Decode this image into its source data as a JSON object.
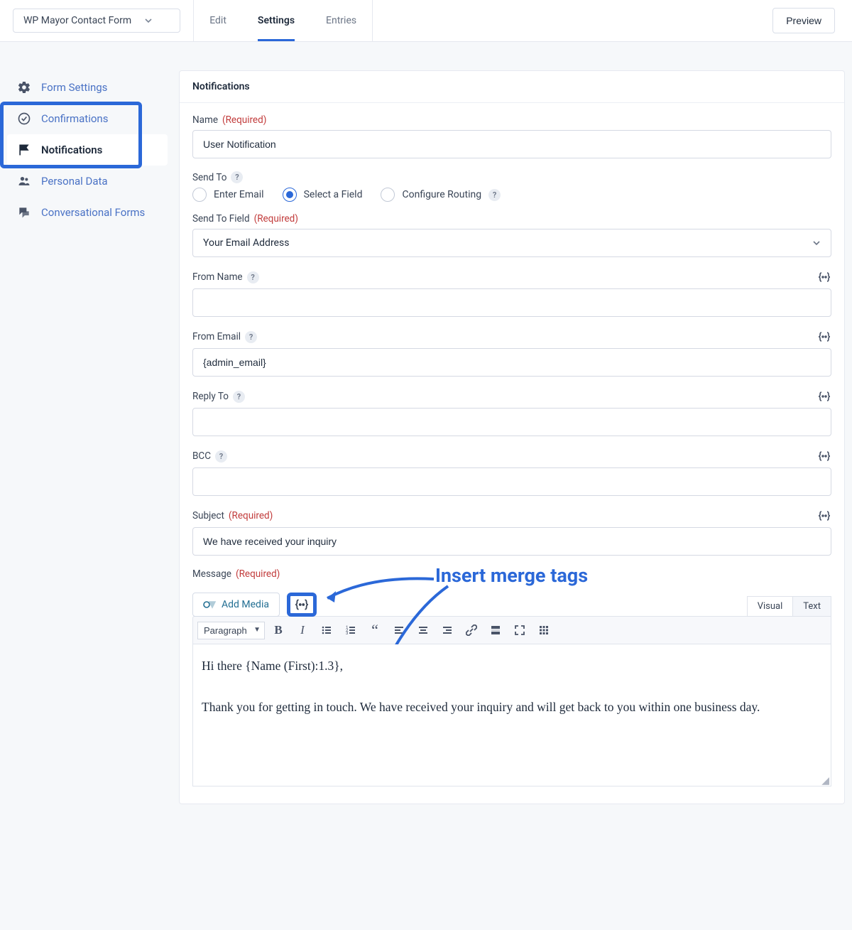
{
  "header": {
    "form_selector": "WP Mayor Contact Form",
    "tabs": {
      "edit": "Edit",
      "settings": "Settings",
      "entries": "Entries"
    },
    "preview": "Preview"
  },
  "sidebar": {
    "items": [
      {
        "label": "Form Settings"
      },
      {
        "label": "Confirmations"
      },
      {
        "label": "Notifications"
      },
      {
        "label": "Personal Data"
      },
      {
        "label": "Conversational Forms"
      }
    ]
  },
  "panel": {
    "title": "Notifications",
    "name_label": "Name",
    "required": "(Required)",
    "name_value": "User Notification",
    "send_to_label": "Send To",
    "send_to_opts": {
      "enter": "Enter Email",
      "field": "Select a Field",
      "routing": "Configure Routing"
    },
    "send_to_field_label": "Send To Field",
    "send_to_field_value": "Your Email Address",
    "from_name_label": "From Name",
    "from_name_value": "",
    "from_email_label": "From Email",
    "from_email_value": "{admin_email}",
    "reply_to_label": "Reply To",
    "reply_to_value": "",
    "bcc_label": "BCC",
    "bcc_value": "",
    "subject_label": "Subject",
    "subject_value": "We have received your inquiry",
    "message_label": "Message",
    "add_media": "Add Media",
    "editor_tabs": {
      "visual": "Visual",
      "text": "Text"
    },
    "format": "Paragraph",
    "message_body_1": "Hi there {Name (First):1.3},",
    "message_body_2": "Thank you for getting in touch. We have received your inquiry and will get back to you within one business day."
  },
  "annotation": {
    "text": "Insert merge tags"
  }
}
